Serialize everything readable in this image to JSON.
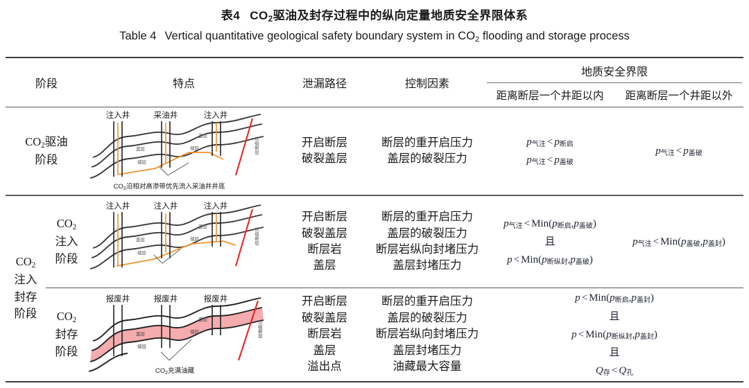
{
  "title": {
    "zh_label": "表4",
    "zh_text": "CO₂驱油及封存过程中的纵向定量地质安全界限体系",
    "zh_pre": "CO",
    "zh_sub": "2",
    "zh_post": "驱油及封存过程中的纵向定量地质安全界限体系",
    "en_label": "Table 4",
    "en_pre": "Vertical quantitative geological safety boundary system in CO",
    "en_sub": "2",
    "en_post": " flooding and storage process"
  },
  "header": {
    "stage": "阶段",
    "feature": "特点",
    "leak_path": "泄漏路径",
    "control_factor": "控制因素",
    "geo_safety": "地质安全界限",
    "within_one_spacing": "距离断层一个井距以内",
    "beyond_one_spacing": "距离断层一个井距以外"
  },
  "rows": [
    {
      "stage_main": "",
      "stage_pre": "CO",
      "stage_sub": "2",
      "stage_post": "驱油",
      "stage_line2": "阶段",
      "diagram": {
        "wells": [
          "注入井",
          "采油井",
          "注入井"
        ],
        "layer_caprock": "盖层",
        "layer_reservoir": "储层",
        "fault_label": "次级断层",
        "caption_pre": "CO",
        "caption_sub": "2",
        "caption_post": "沿相对高渗带优先流入采油井井底",
        "reservoir_filled": false
      },
      "leak_paths": [
        "开启断层",
        "破裂盖层"
      ],
      "control_factors": [
        "断层的重开启压力",
        "盖层的破裂压力"
      ],
      "within": [
        {
          "left_var": "p",
          "left_sub": "气注",
          "op": "<",
          "right": [
            {
              "var": "p",
              "sub": "断启"
            }
          ],
          "func": ""
        },
        {
          "left_var": "p",
          "left_sub": "气注",
          "op": "<",
          "right": [
            {
              "var": "p",
              "sub": "盖破"
            }
          ],
          "func": ""
        }
      ],
      "beyond": [
        {
          "left_var": "p",
          "left_sub": "气注",
          "op": "<",
          "right": [
            {
              "var": "p",
              "sub": "盖破"
            }
          ],
          "func": ""
        }
      ]
    },
    {
      "stage_main": "",
      "stage_pre": "CO",
      "stage_sub": "2",
      "stage_post": "",
      "stage_line2": "注入",
      "stage_line3": "阶段",
      "diagram": {
        "wells": [
          "注入井",
          "注入井",
          "注入井"
        ],
        "layer_caprock": "盖层",
        "layer_reservoir": "储层",
        "fault_label": "次级断层",
        "caption_pre": "",
        "caption_sub": "",
        "caption_post": "",
        "reservoir_filled": false
      },
      "leak_paths": [
        "开启断层",
        "破裂盖层",
        "断层岩",
        "盖层"
      ],
      "control_factors": [
        "断层的重开启压力",
        "盖层的破裂压力",
        "断层岩纵向封堵压力",
        "盖层封堵压力"
      ],
      "within": [
        {
          "left_var": "p",
          "left_sub": "气注",
          "op": "<",
          "func": "Min",
          "right": [
            {
              "var": "p",
              "sub": "断启"
            },
            {
              "var": "p",
              "sub": "盖破"
            }
          ]
        },
        {
          "conj": "且"
        },
        {
          "left_var": "p",
          "left_sub": "",
          "op": "<",
          "func": "Min",
          "right": [
            {
              "var": "p",
              "sub": "断纵封"
            },
            {
              "var": "p",
              "sub": "盖破"
            }
          ]
        }
      ],
      "beyond": [
        {
          "left_var": "p",
          "left_sub": "气注",
          "op": "<",
          "func": "Min",
          "right": [
            {
              "var": "p",
              "sub": "盖破"
            },
            {
              "var": "p",
              "sub": "盖封"
            }
          ]
        }
      ]
    },
    {
      "stage_main": "",
      "stage_pre": "CO",
      "stage_sub": "2",
      "stage_post": "",
      "stage_line2": "封存",
      "stage_line3": "阶段",
      "diagram": {
        "wells": [
          "报废井",
          "报废井",
          "报废井"
        ],
        "layer_caprock": "盖层",
        "layer_reservoir": "储层",
        "fault_label": "次级断层",
        "caption_pre": "CO",
        "caption_sub": "2",
        "caption_post": "充满油藏",
        "reservoir_filled": true
      },
      "leak_paths": [
        "开启断层",
        "破裂盖层",
        "断层岩",
        "盖层",
        "溢出点"
      ],
      "control_factors": [
        "断层的重开启压力",
        "盖层的破裂压力",
        "断层岩纵向封堵压力",
        "盖层封堵压力",
        "油藏最大容量"
      ],
      "within": [
        {
          "left_var": "p",
          "left_sub": "",
          "op": "<",
          "func": "Min",
          "right": [
            {
              "var": "p",
              "sub": "断启"
            },
            {
              "var": "p",
              "sub": "盖封"
            }
          ]
        },
        {
          "conj": "且"
        },
        {
          "left_var": "p",
          "left_sub": "",
          "op": "<",
          "func": "Min",
          "right": [
            {
              "var": "p",
              "sub": "断纵封"
            },
            {
              "var": "p",
              "sub": "盖封"
            }
          ]
        },
        {
          "conj": "且"
        },
        {
          "left_var": "Q",
          "left_sub": "存",
          "op": "<",
          "func": "",
          "right": [
            {
              "var": "Q",
              "sub": "孔"
            }
          ]
        }
      ],
      "beyond": []
    }
  ],
  "merged_stage": {
    "pre": "CO",
    "sub": "2",
    "lines": [
      "注入",
      "封存",
      "阶段"
    ]
  },
  "colors": {
    "fault": "#ee2222",
    "co2_path": "#f0922b",
    "reservoir_fill": "#f4acae",
    "rock_line": "#3a3a3a",
    "rule": "#3d3d3d"
  }
}
